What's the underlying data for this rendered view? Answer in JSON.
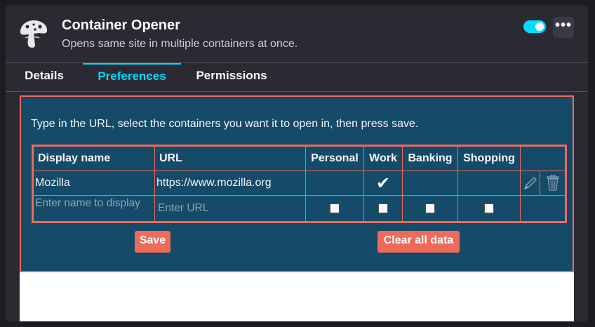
{
  "header": {
    "title": "Container Opener",
    "subtitle": "Opens same site in multiple containers at once.",
    "enabled": true,
    "more_label": "•••"
  },
  "tabs": [
    {
      "label": "Details",
      "active": false
    },
    {
      "label": "Preferences",
      "active": true
    },
    {
      "label": "Permissions",
      "active": false
    }
  ],
  "preferences": {
    "intro": "Type in the URL, select the containers you want it to open in, then press save.",
    "columns": [
      "Display name",
      "URL",
      "Personal",
      "Work",
      "Banking",
      "Shopping"
    ],
    "rows": [
      {
        "name": "Mozilla",
        "url": "https://www.mozilla.org",
        "personal": false,
        "work": true,
        "banking": false,
        "shopping": false
      }
    ],
    "new_row": {
      "name_placeholder": "Enter name to display",
      "url_placeholder": "Enter URL"
    },
    "check_glyph": "✔",
    "save_label": "Save",
    "clear_label": "Clear all data"
  },
  "colors": {
    "accent": "#00ddff",
    "panel": "#154a68",
    "button": "#f06a5a"
  }
}
